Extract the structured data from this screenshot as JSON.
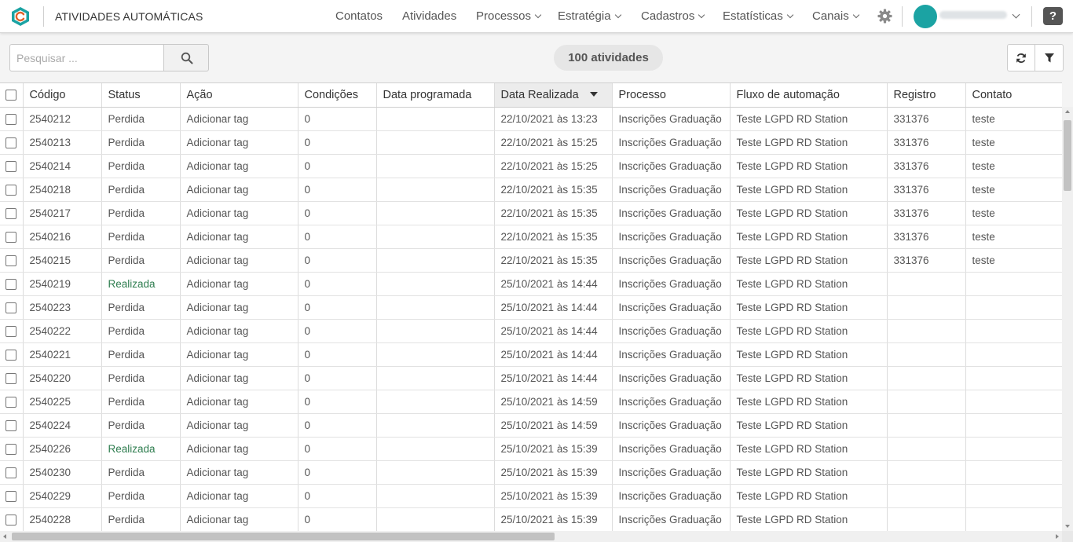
{
  "app": {
    "title": "ATIVIDADES AUTOMÁTICAS",
    "brand_color": "#1ba3a3"
  },
  "nav": {
    "items": [
      {
        "label": "Contatos",
        "dropdown": false
      },
      {
        "label": "Atividades",
        "dropdown": false
      },
      {
        "label": "Processos",
        "dropdown": true
      },
      {
        "label": "Estratégia",
        "dropdown": true
      },
      {
        "label": "Cadastros",
        "dropdown": true
      },
      {
        "label": "Estatísticas",
        "dropdown": true
      },
      {
        "label": "Canais",
        "dropdown": true
      }
    ],
    "help_label": "?"
  },
  "toolbar": {
    "search_placeholder": "Pesquisar ...",
    "search_value": "",
    "count_label": "100 atividades"
  },
  "table": {
    "columns": [
      "Código",
      "Status",
      "Ação",
      "Condições",
      "Data programada",
      "Data Realizada",
      "Processo",
      "Fluxo de automação",
      "Registro",
      "Contato"
    ],
    "sorted_column": "Data Realizada",
    "sort_direction": "desc",
    "rows": [
      [
        "2540212",
        "Perdida",
        "Adicionar tag",
        "0",
        "",
        "22/10/2021 às 13:23",
        "Inscrições Graduação",
        "Teste LGPD RD Station",
        "331376",
        "teste"
      ],
      [
        "2540213",
        "Perdida",
        "Adicionar tag",
        "0",
        "",
        "22/10/2021 às 15:25",
        "Inscrições Graduação",
        "Teste LGPD RD Station",
        "331376",
        "teste"
      ],
      [
        "2540214",
        "Perdida",
        "Adicionar tag",
        "0",
        "",
        "22/10/2021 às 15:25",
        "Inscrições Graduação",
        "Teste LGPD RD Station",
        "331376",
        "teste"
      ],
      [
        "2540218",
        "Perdida",
        "Adicionar tag",
        "0",
        "",
        "22/10/2021 às 15:35",
        "Inscrições Graduação",
        "Teste LGPD RD Station",
        "331376",
        "teste"
      ],
      [
        "2540217",
        "Perdida",
        "Adicionar tag",
        "0",
        "",
        "22/10/2021 às 15:35",
        "Inscrições Graduação",
        "Teste LGPD RD Station",
        "331376",
        "teste"
      ],
      [
        "2540216",
        "Perdida",
        "Adicionar tag",
        "0",
        "",
        "22/10/2021 às 15:35",
        "Inscrições Graduação",
        "Teste LGPD RD Station",
        "331376",
        "teste"
      ],
      [
        "2540215",
        "Perdida",
        "Adicionar tag",
        "0",
        "",
        "22/10/2021 às 15:35",
        "Inscrições Graduação",
        "Teste LGPD RD Station",
        "331376",
        "teste"
      ],
      [
        "2540219",
        "Realizada",
        "Adicionar tag",
        "0",
        "",
        "25/10/2021 às 14:44",
        "Inscrições Graduação",
        "Teste LGPD RD Station",
        "",
        ""
      ],
      [
        "2540223",
        "Perdida",
        "Adicionar tag",
        "0",
        "",
        "25/10/2021 às 14:44",
        "Inscrições Graduação",
        "Teste LGPD RD Station",
        "",
        ""
      ],
      [
        "2540222",
        "Perdida",
        "Adicionar tag",
        "0",
        "",
        "25/10/2021 às 14:44",
        "Inscrições Graduação",
        "Teste LGPD RD Station",
        "",
        ""
      ],
      [
        "2540221",
        "Perdida",
        "Adicionar tag",
        "0",
        "",
        "25/10/2021 às 14:44",
        "Inscrições Graduação",
        "Teste LGPD RD Station",
        "",
        ""
      ],
      [
        "2540220",
        "Perdida",
        "Adicionar tag",
        "0",
        "",
        "25/10/2021 às 14:44",
        "Inscrições Graduação",
        "Teste LGPD RD Station",
        "",
        ""
      ],
      [
        "2540225",
        "Perdida",
        "Adicionar tag",
        "0",
        "",
        "25/10/2021 às 14:59",
        "Inscrições Graduação",
        "Teste LGPD RD Station",
        "",
        ""
      ],
      [
        "2540224",
        "Perdida",
        "Adicionar tag",
        "0",
        "",
        "25/10/2021 às 14:59",
        "Inscrições Graduação",
        "Teste LGPD RD Station",
        "",
        ""
      ],
      [
        "2540226",
        "Realizada",
        "Adicionar tag",
        "0",
        "",
        "25/10/2021 às 15:39",
        "Inscrições Graduação",
        "Teste LGPD RD Station",
        "",
        ""
      ],
      [
        "2540230",
        "Perdida",
        "Adicionar tag",
        "0",
        "",
        "25/10/2021 às 15:39",
        "Inscrições Graduação",
        "Teste LGPD RD Station",
        "",
        ""
      ],
      [
        "2540229",
        "Perdida",
        "Adicionar tag",
        "0",
        "",
        "25/10/2021 às 15:39",
        "Inscrições Graduação",
        "Teste LGPD RD Station",
        "",
        ""
      ],
      [
        "2540228",
        "Perdida",
        "Adicionar tag",
        "0",
        "",
        "25/10/2021 às 15:39",
        "Inscrições Graduação",
        "Teste LGPD RD Station",
        "",
        ""
      ]
    ]
  },
  "colors": {
    "status_realizada": "#2e7d4f",
    "status_perdida": "#555555",
    "sorted_header_bg": "#ececec"
  }
}
